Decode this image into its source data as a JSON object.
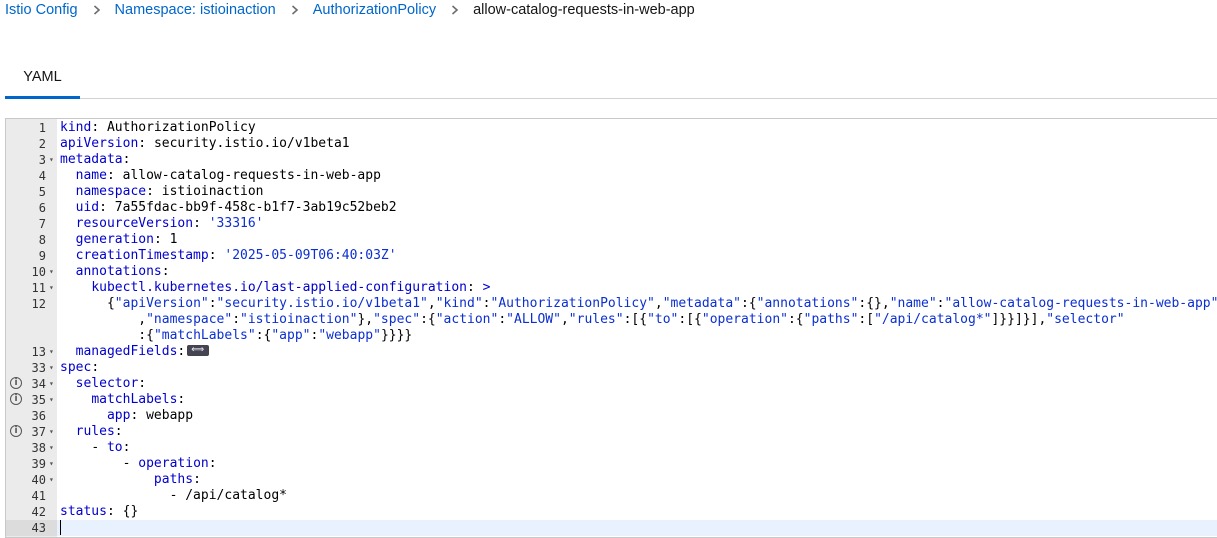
{
  "breadcrumb": {
    "items": [
      "Istio Config",
      "Namespace: istioinaction",
      "AuthorizationPolicy"
    ],
    "current": "allow-catalog-requests-in-web-app"
  },
  "tabs": {
    "yaml_label": "YAML"
  },
  "editor": {
    "lines": [
      {
        "num": "1",
        "fold": false,
        "info": false,
        "segs": [
          [
            "k",
            "kind"
          ],
          [
            "p",
            ": "
          ],
          [
            "w",
            "AuthorizationPolicy"
          ]
        ]
      },
      {
        "num": "2",
        "fold": false,
        "info": false,
        "segs": [
          [
            "k",
            "apiVersion"
          ],
          [
            "p",
            ": "
          ],
          [
            "w",
            "security.istio.io/v1beta1"
          ]
        ]
      },
      {
        "num": "3",
        "fold": true,
        "info": false,
        "segs": [
          [
            "k",
            "metadata"
          ],
          [
            "p",
            ":"
          ]
        ]
      },
      {
        "num": "4",
        "fold": false,
        "info": false,
        "segs": [
          [
            "w",
            "  "
          ],
          [
            "k",
            "name"
          ],
          [
            "p",
            ": "
          ],
          [
            "w",
            "allow-catalog-requests-in-web-app"
          ]
        ]
      },
      {
        "num": "5",
        "fold": false,
        "info": false,
        "segs": [
          [
            "w",
            "  "
          ],
          [
            "k",
            "namespace"
          ],
          [
            "p",
            ": "
          ],
          [
            "w",
            "istioinaction"
          ]
        ]
      },
      {
        "num": "6",
        "fold": false,
        "info": false,
        "segs": [
          [
            "w",
            "  "
          ],
          [
            "k",
            "uid"
          ],
          [
            "p",
            ": "
          ],
          [
            "w",
            "7a55fdac-bb9f-458c-b1f7-3ab19c52beb2"
          ]
        ]
      },
      {
        "num": "7",
        "fold": false,
        "info": false,
        "segs": [
          [
            "w",
            "  "
          ],
          [
            "k",
            "resourceVersion"
          ],
          [
            "p",
            ": "
          ],
          [
            "s",
            "'33316'"
          ]
        ]
      },
      {
        "num": "8",
        "fold": false,
        "info": false,
        "segs": [
          [
            "w",
            "  "
          ],
          [
            "k",
            "generation"
          ],
          [
            "p",
            ": "
          ],
          [
            "w",
            "1"
          ]
        ]
      },
      {
        "num": "9",
        "fold": false,
        "info": false,
        "segs": [
          [
            "w",
            "  "
          ],
          [
            "k",
            "creationTimestamp"
          ],
          [
            "p",
            ": "
          ],
          [
            "s",
            "'2025-05-09T06:40:03Z'"
          ]
        ]
      },
      {
        "num": "10",
        "fold": true,
        "info": false,
        "segs": [
          [
            "w",
            "  "
          ],
          [
            "k",
            "annotations"
          ],
          [
            "p",
            ":"
          ]
        ]
      },
      {
        "num": "11",
        "fold": true,
        "info": false,
        "segs": [
          [
            "w",
            "    "
          ],
          [
            "k",
            "kubectl.kubernetes.io/last-applied-configuration"
          ],
          [
            "p",
            ": "
          ],
          [
            "k",
            ">"
          ]
        ]
      },
      {
        "num": "12",
        "fold": false,
        "info": false,
        "segs": [
          [
            "w",
            "      "
          ],
          [
            "p",
            "{"
          ],
          [
            "s",
            "\"apiVersion\""
          ],
          [
            "p",
            ":"
          ],
          [
            "s",
            "\"security.istio.io/v1beta1\""
          ],
          [
            "p",
            ","
          ],
          [
            "s",
            "\"kind\""
          ],
          [
            "p",
            ":"
          ],
          [
            "s",
            "\"AuthorizationPolicy\""
          ],
          [
            "p",
            ","
          ],
          [
            "s",
            "\"metadata\""
          ],
          [
            "p",
            ":{"
          ],
          [
            "s",
            "\"annotations\""
          ],
          [
            "p",
            ":{},"
          ],
          [
            "s",
            "\"name\""
          ],
          [
            "p",
            ":"
          ],
          [
            "s",
            "\"allow-catalog-requests-in-web-app\""
          ]
        ]
      },
      {
        "num": "",
        "fold": false,
        "info": false,
        "segs": [
          [
            "w",
            "          "
          ],
          [
            "p",
            ","
          ],
          [
            "s",
            "\"namespace\""
          ],
          [
            "p",
            ":"
          ],
          [
            "s",
            "\"istioinaction\""
          ],
          [
            "p",
            "},"
          ],
          [
            "s",
            "\"spec\""
          ],
          [
            "p",
            ":{"
          ],
          [
            "s",
            "\"action\""
          ],
          [
            "p",
            ":"
          ],
          [
            "s",
            "\"ALLOW\""
          ],
          [
            "p",
            ","
          ],
          [
            "s",
            "\"rules\""
          ],
          [
            "p",
            ":[{"
          ],
          [
            "s",
            "\"to\""
          ],
          [
            "p",
            ":[{"
          ],
          [
            "s",
            "\"operation\""
          ],
          [
            "p",
            ":{"
          ],
          [
            "s",
            "\"paths\""
          ],
          [
            "p",
            ":["
          ],
          [
            "s",
            "\"/api/catalog*\""
          ],
          [
            "p",
            "]}}]}],"
          ],
          [
            "s",
            "\"selector\""
          ]
        ]
      },
      {
        "num": "",
        "fold": false,
        "info": false,
        "segs": [
          [
            "w",
            "          "
          ],
          [
            "p",
            ":{"
          ],
          [
            "s",
            "\"matchLabels\""
          ],
          [
            "p",
            ":{"
          ],
          [
            "s",
            "\"app\""
          ],
          [
            "p",
            ":"
          ],
          [
            "s",
            "\"webapp\""
          ],
          [
            "p",
            "}}}}"
          ]
        ]
      },
      {
        "num": "13",
        "fold": true,
        "info": false,
        "widget": true,
        "segs": [
          [
            "w",
            "  "
          ],
          [
            "k",
            "managedFields"
          ],
          [
            "p",
            ":"
          ]
        ]
      },
      {
        "num": "33",
        "fold": true,
        "info": false,
        "segs": [
          [
            "k",
            "spec"
          ],
          [
            "p",
            ":"
          ]
        ]
      },
      {
        "num": "34",
        "fold": true,
        "info": true,
        "segs": [
          [
            "w",
            "  "
          ],
          [
            "k",
            "selector"
          ],
          [
            "p",
            ":"
          ]
        ]
      },
      {
        "num": "35",
        "fold": true,
        "info": true,
        "segs": [
          [
            "w",
            "    "
          ],
          [
            "k",
            "matchLabels"
          ],
          [
            "p",
            ":"
          ]
        ]
      },
      {
        "num": "36",
        "fold": false,
        "info": false,
        "segs": [
          [
            "w",
            "      "
          ],
          [
            "k",
            "app"
          ],
          [
            "p",
            ": "
          ],
          [
            "w",
            "webapp"
          ]
        ]
      },
      {
        "num": "37",
        "fold": true,
        "info": true,
        "segs": [
          [
            "w",
            "  "
          ],
          [
            "k",
            "rules"
          ],
          [
            "p",
            ":"
          ]
        ]
      },
      {
        "num": "38",
        "fold": true,
        "info": false,
        "segs": [
          [
            "w",
            "    "
          ],
          [
            "p",
            "- "
          ],
          [
            "k",
            "to"
          ],
          [
            "p",
            ":"
          ]
        ]
      },
      {
        "num": "39",
        "fold": true,
        "info": false,
        "segs": [
          [
            "w",
            "        "
          ],
          [
            "p",
            "- "
          ],
          [
            "k",
            "operation"
          ],
          [
            "p",
            ":"
          ]
        ]
      },
      {
        "num": "40",
        "fold": true,
        "info": false,
        "segs": [
          [
            "w",
            "            "
          ],
          [
            "k",
            "paths"
          ],
          [
            "p",
            ":"
          ]
        ]
      },
      {
        "num": "41",
        "fold": false,
        "info": false,
        "segs": [
          [
            "w",
            "              "
          ],
          [
            "p",
            "- "
          ],
          [
            "w",
            "/api/catalog*"
          ]
        ]
      },
      {
        "num": "42",
        "fold": false,
        "info": false,
        "segs": [
          [
            "k",
            "status"
          ],
          [
            "p",
            ": "
          ],
          [
            "w",
            "{}"
          ]
        ]
      },
      {
        "num": "43",
        "fold": false,
        "info": false,
        "active": true,
        "segs": []
      }
    ]
  }
}
